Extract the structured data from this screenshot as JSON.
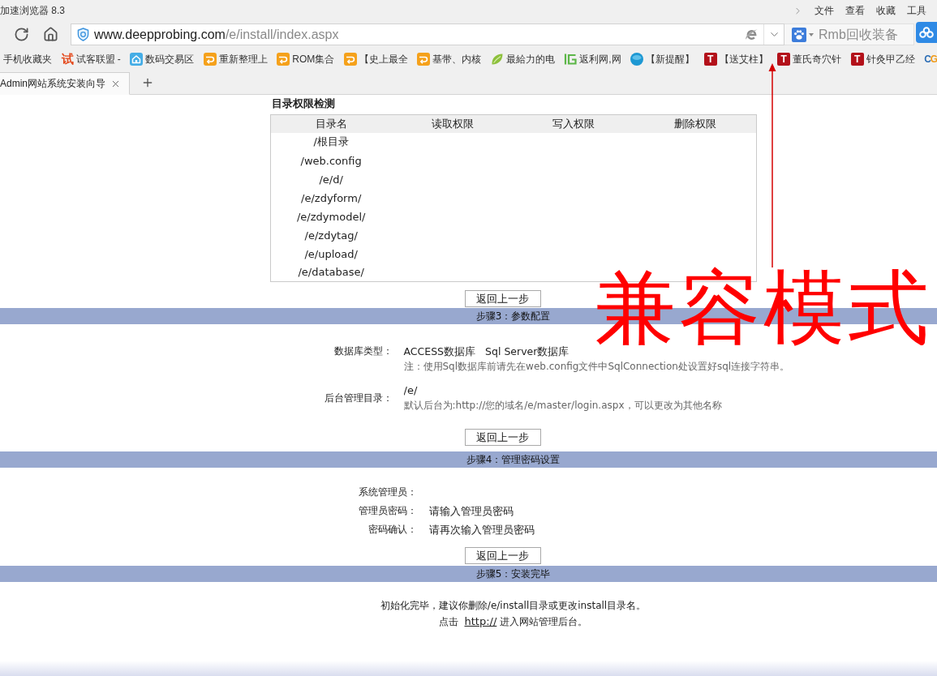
{
  "browser": {
    "title": "加速浏览器 8.3",
    "menu": [
      "文件",
      "查看",
      "收藏",
      "工具"
    ],
    "url_host": "www.deepprobing.com",
    "url_path": "/e/install/index.aspx",
    "search_placeholder": "Rmb回收装备",
    "bookmarks": [
      {
        "kind": "none",
        "label": "手机收藏夹"
      },
      {
        "kind": "glyph",
        "glyph": "试",
        "label": "试客联盟 -"
      },
      {
        "kind": "house",
        "label": "数码交易区"
      },
      {
        "kind": "swirl",
        "label": "重新整理上"
      },
      {
        "kind": "swirl",
        "label": "ROM集合"
      },
      {
        "kind": "swirl",
        "label": "【史上最全"
      },
      {
        "kind": "swirl",
        "label": "基带、内核"
      },
      {
        "kind": "leaf",
        "label": "最給力的电"
      },
      {
        "kind": "bracket",
        "label": "返利网,网"
      },
      {
        "kind": "disc",
        "label": "【新提醒】"
      },
      {
        "kind": "letter-tile",
        "glyph": "T",
        "label": "【送艾柱】"
      },
      {
        "kind": "letter-tile",
        "glyph": "T",
        "label": "董氏奇穴针"
      },
      {
        "kind": "letter-tile",
        "glyph": "T",
        "label": "针灸甲乙经"
      },
      {
        "kind": "letter-logo",
        "glyph": "CG"
      }
    ],
    "tabs": [
      {
        "title": "Admin网站系统安装向导",
        "selected": true
      }
    ]
  },
  "permissions": {
    "title": "目录权限检测",
    "columns": [
      "目录名",
      "读取权限",
      "写入权限",
      "删除权限"
    ],
    "rows": [
      {
        "directory": "/根目录"
      },
      {
        "directory": "/web.config"
      },
      {
        "directory": "/e/d/"
      },
      {
        "directory": "/e/zdyform/"
      },
      {
        "directory": "/e/zdymodel/"
      },
      {
        "directory": "/e/zdytag/"
      },
      {
        "directory": "/e/upload/"
      },
      {
        "directory": "/e/database/"
      }
    ],
    "back_button": "返回上一步"
  },
  "step3": {
    "title": "步骤3：参数配置",
    "database_type": {
      "label": "数据库类型：",
      "options": [
        "ACCESS数据库",
        "Sql Server数据库"
      ],
      "note": "注：使用Sql数据库前请先在web.config文件中SqlConnection处设置好sql连接字符串。"
    },
    "admin_dir": {
      "label": "后台管理目录：",
      "value": "/e/",
      "hint": "默认后台为:http://您的域名/e/master/login.aspx，可以更改为其他名称"
    },
    "back_button": "返回上一步"
  },
  "step4": {
    "title": "步骤4：管理密码设置",
    "fields": [
      {
        "label": "系统管理员："
      },
      {
        "label": "管理员密码：",
        "placeholder": "请输入管理员密码"
      },
      {
        "label": "密码确认：",
        "placeholder": "请再次输入管理员密码"
      }
    ],
    "back_button": "返回上一步"
  },
  "step5": {
    "title": "步骤5：安装完毕",
    "message": "初始化完毕，建议你删除/e/install目录或更改install目录名。",
    "link_prefix": "点击",
    "link": "http://",
    "link_suffix": "进入网站管理后台。"
  },
  "annotation": {
    "text": "兼容模式",
    "arrow": true
  }
}
